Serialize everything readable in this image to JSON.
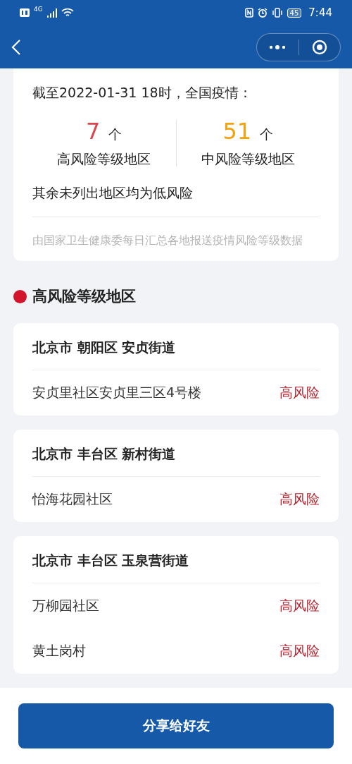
{
  "status_bar": {
    "network": "4G",
    "battery": "45",
    "time": "7:44"
  },
  "summary": {
    "heading": "截至2022-01-31 18时，全国疫情：",
    "stats": [
      {
        "kind": "high",
        "number": "7",
        "unit": "个",
        "label": "高风险等级地区"
      },
      {
        "kind": "medium",
        "number": "51",
        "unit": "个",
        "label": "中风险等级地区"
      }
    ],
    "note": "其余未列出地区均为低风险",
    "source": "由国家卫生健康委每日汇总各地报送疫情风险等级数据"
  },
  "section": {
    "title": "高风险等级地区"
  },
  "areas": [
    {
      "title": "北京市 朝阳区 安贞街道",
      "places": [
        {
          "name": "安贞里社区安贞里三区4号楼",
          "risk": "高风险"
        }
      ]
    },
    {
      "title": "北京市 丰台区 新村街道",
      "places": [
        {
          "name": "怡海花园社区",
          "risk": "高风险"
        }
      ]
    },
    {
      "title": "北京市 丰台区 玉泉营街道",
      "places": [
        {
          "name": "万柳园社区",
          "risk": "高风险"
        },
        {
          "name": "黄土岗村",
          "risk": "高风险"
        }
      ]
    }
  ],
  "share_button": "分享给好友"
}
